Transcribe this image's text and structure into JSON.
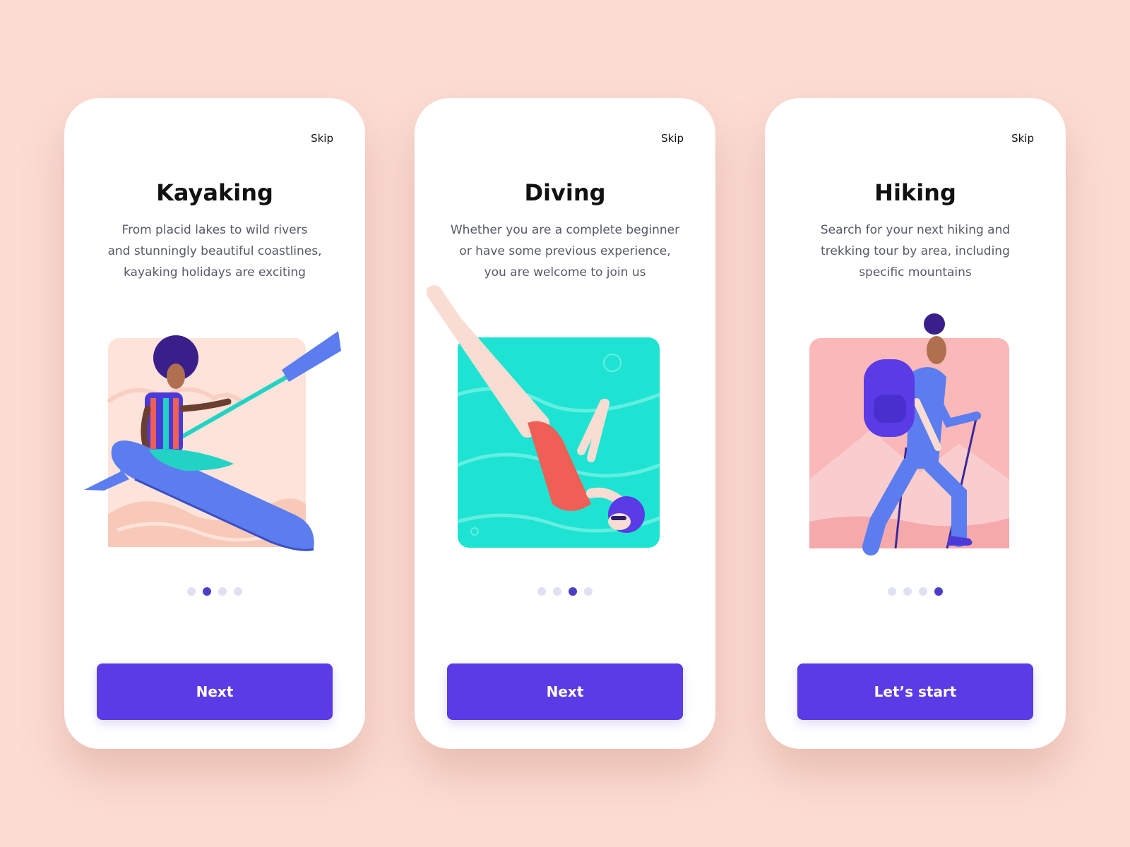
{
  "colors": {
    "background": "#fcdcd3",
    "card": "#ffffff",
    "accent_button": "#5a3be6",
    "dot_active": "#4a40c7",
    "dot_inactive": "#e0e0f3"
  },
  "screens": [
    {
      "skip_label": "Skip",
      "title": "Kayaking",
      "description_lines": [
        "From placid lakes to wild rivers",
        "and stunningly beautiful coastlines,",
        "kayaking holidays are exciting"
      ],
      "illustration": "kayaker-illustration",
      "page_indicator": {
        "total": 4,
        "active": 2
      },
      "button_label": "Next"
    },
    {
      "skip_label": "Skip",
      "title": "Diving",
      "description_lines": [
        "Whether you are a complete beginner",
        "or have some previous experience,",
        "you are welcome to join us"
      ],
      "illustration": "diver-illustration",
      "page_indicator": {
        "total": 4,
        "active": 3
      },
      "button_label": "Next"
    },
    {
      "skip_label": "Skip",
      "title": "Hiking",
      "description_lines": [
        "Search for your next hiking and",
        "trekking tour by area, including",
        "specific mountains"
      ],
      "illustration": "hiker-illustration",
      "page_indicator": {
        "total": 4,
        "active": 4
      },
      "button_label": "Let’s start"
    }
  ]
}
